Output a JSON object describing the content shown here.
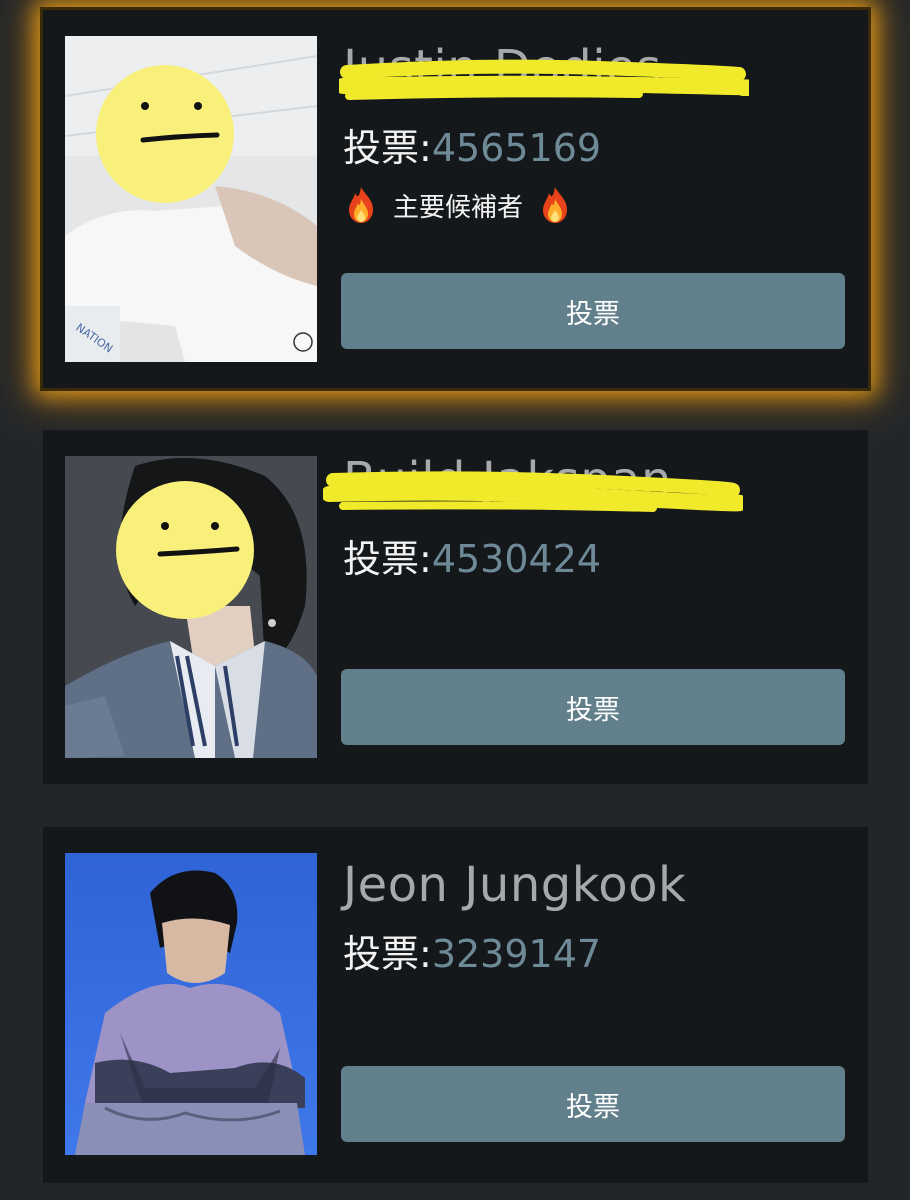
{
  "colors": {
    "page_background": "#22262a",
    "card_background": "#14181b",
    "featured_glow": "#f5a623",
    "vote_button": "#62808c",
    "vote_count_text": "#6f8a97",
    "name_text": "#a6a8aa",
    "scribble_yellow": "#f0ea2a"
  },
  "candidates": [
    {
      "name": "Justin Dodies",
      "vote_label": "投票:",
      "vote_count": "4565169",
      "badge": "主要候補者",
      "badge_icon": "fire-emoji",
      "button_label": "投票",
      "photo_icon": "redacted-face-emoji",
      "featured": true
    },
    {
      "name": "Build Jakspan",
      "vote_label": "投票:",
      "vote_count": "4530424",
      "button_label": "投票",
      "photo_icon": "redacted-face-emoji",
      "featured": false
    },
    {
      "name": "Jeon Jungkook",
      "vote_label": "投票:",
      "vote_count": "3239147",
      "button_label": "投票",
      "featured": false
    }
  ]
}
